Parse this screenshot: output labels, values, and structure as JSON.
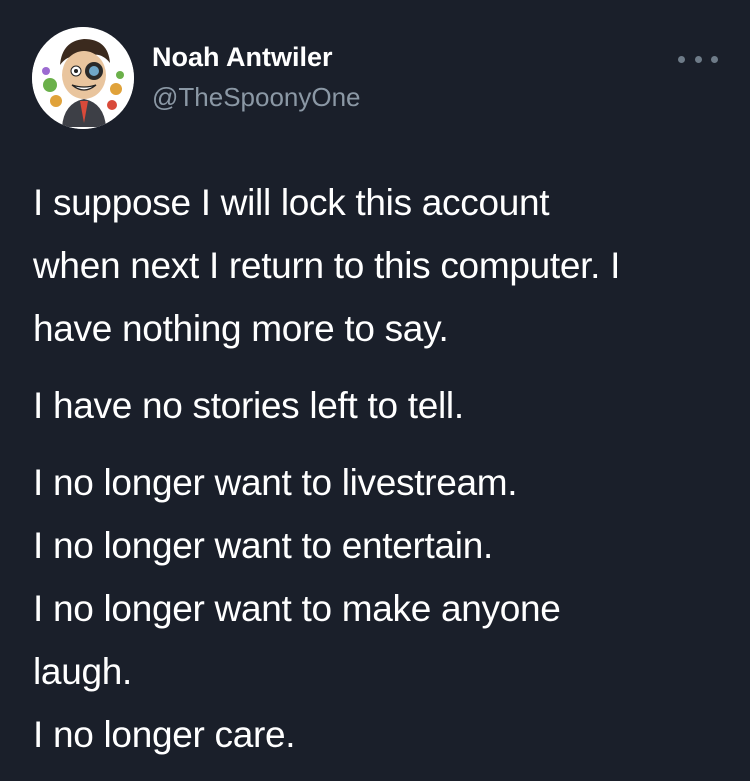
{
  "tweet": {
    "author": {
      "display_name": "Noah Antwiler",
      "handle": "@TheSpoonyOne",
      "avatar_icon": "cartoon-avatar"
    },
    "more_icon": "more-dots-icon",
    "body": {
      "paragraphs": [
        {
          "lines": [
            "I suppose I will lock this account",
            "when next I return to this computer. I",
            "have nothing more to say."
          ]
        },
        {
          "lines": [
            "I have no stories left to tell."
          ]
        },
        {
          "lines": [
            "I no longer want to livestream.",
            "I no longer want to entertain.",
            "I no longer want to make anyone",
            "laugh.",
            "I no longer care."
          ]
        }
      ]
    }
  },
  "colors": {
    "background": "#1a1f2a",
    "text": "#ffffff",
    "secondary_text": "#8b98a5"
  }
}
